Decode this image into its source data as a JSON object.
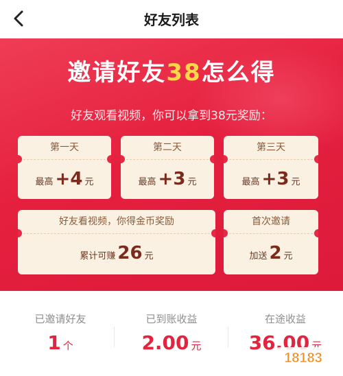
{
  "header": {
    "title": "好友列表",
    "back_icon": "back-arrow-icon"
  },
  "banner": {
    "headline_pre": "邀请好友",
    "headline_num": "38",
    "headline_post": "怎么得",
    "subline": "好友观看视频，你可以拿到38元奖励：",
    "tickets": [
      {
        "title": "第一天",
        "prefix": "最高",
        "amount": "+4",
        "unit": "元"
      },
      {
        "title": "第二天",
        "prefix": "最高",
        "amount": "+3",
        "unit": "元"
      },
      {
        "title": "第三天",
        "prefix": "最高",
        "amount": "+3",
        "unit": "元"
      },
      {
        "title": "好友看视频，你得金币奖励",
        "prefix": "累计可赚",
        "amount": "26",
        "unit": "元"
      },
      {
        "title": "首次邀请",
        "prefix": "加送",
        "amount": "2",
        "unit": "元"
      }
    ]
  },
  "stats": [
    {
      "label": "已邀请好友",
      "value": "1",
      "unit": "个"
    },
    {
      "label": "已到账收益",
      "value": "2.00",
      "unit": "元"
    },
    {
      "label": "在途收益",
      "value": "36.00",
      "unit": "元"
    }
  ],
  "watermark": {
    "text": "18183"
  },
  "colors": {
    "accent_red": "#e3243e",
    "banner_red": "#e52a45",
    "ticket_bg": "#fbf1e2",
    "highlight_yellow": "#ffd54a"
  }
}
